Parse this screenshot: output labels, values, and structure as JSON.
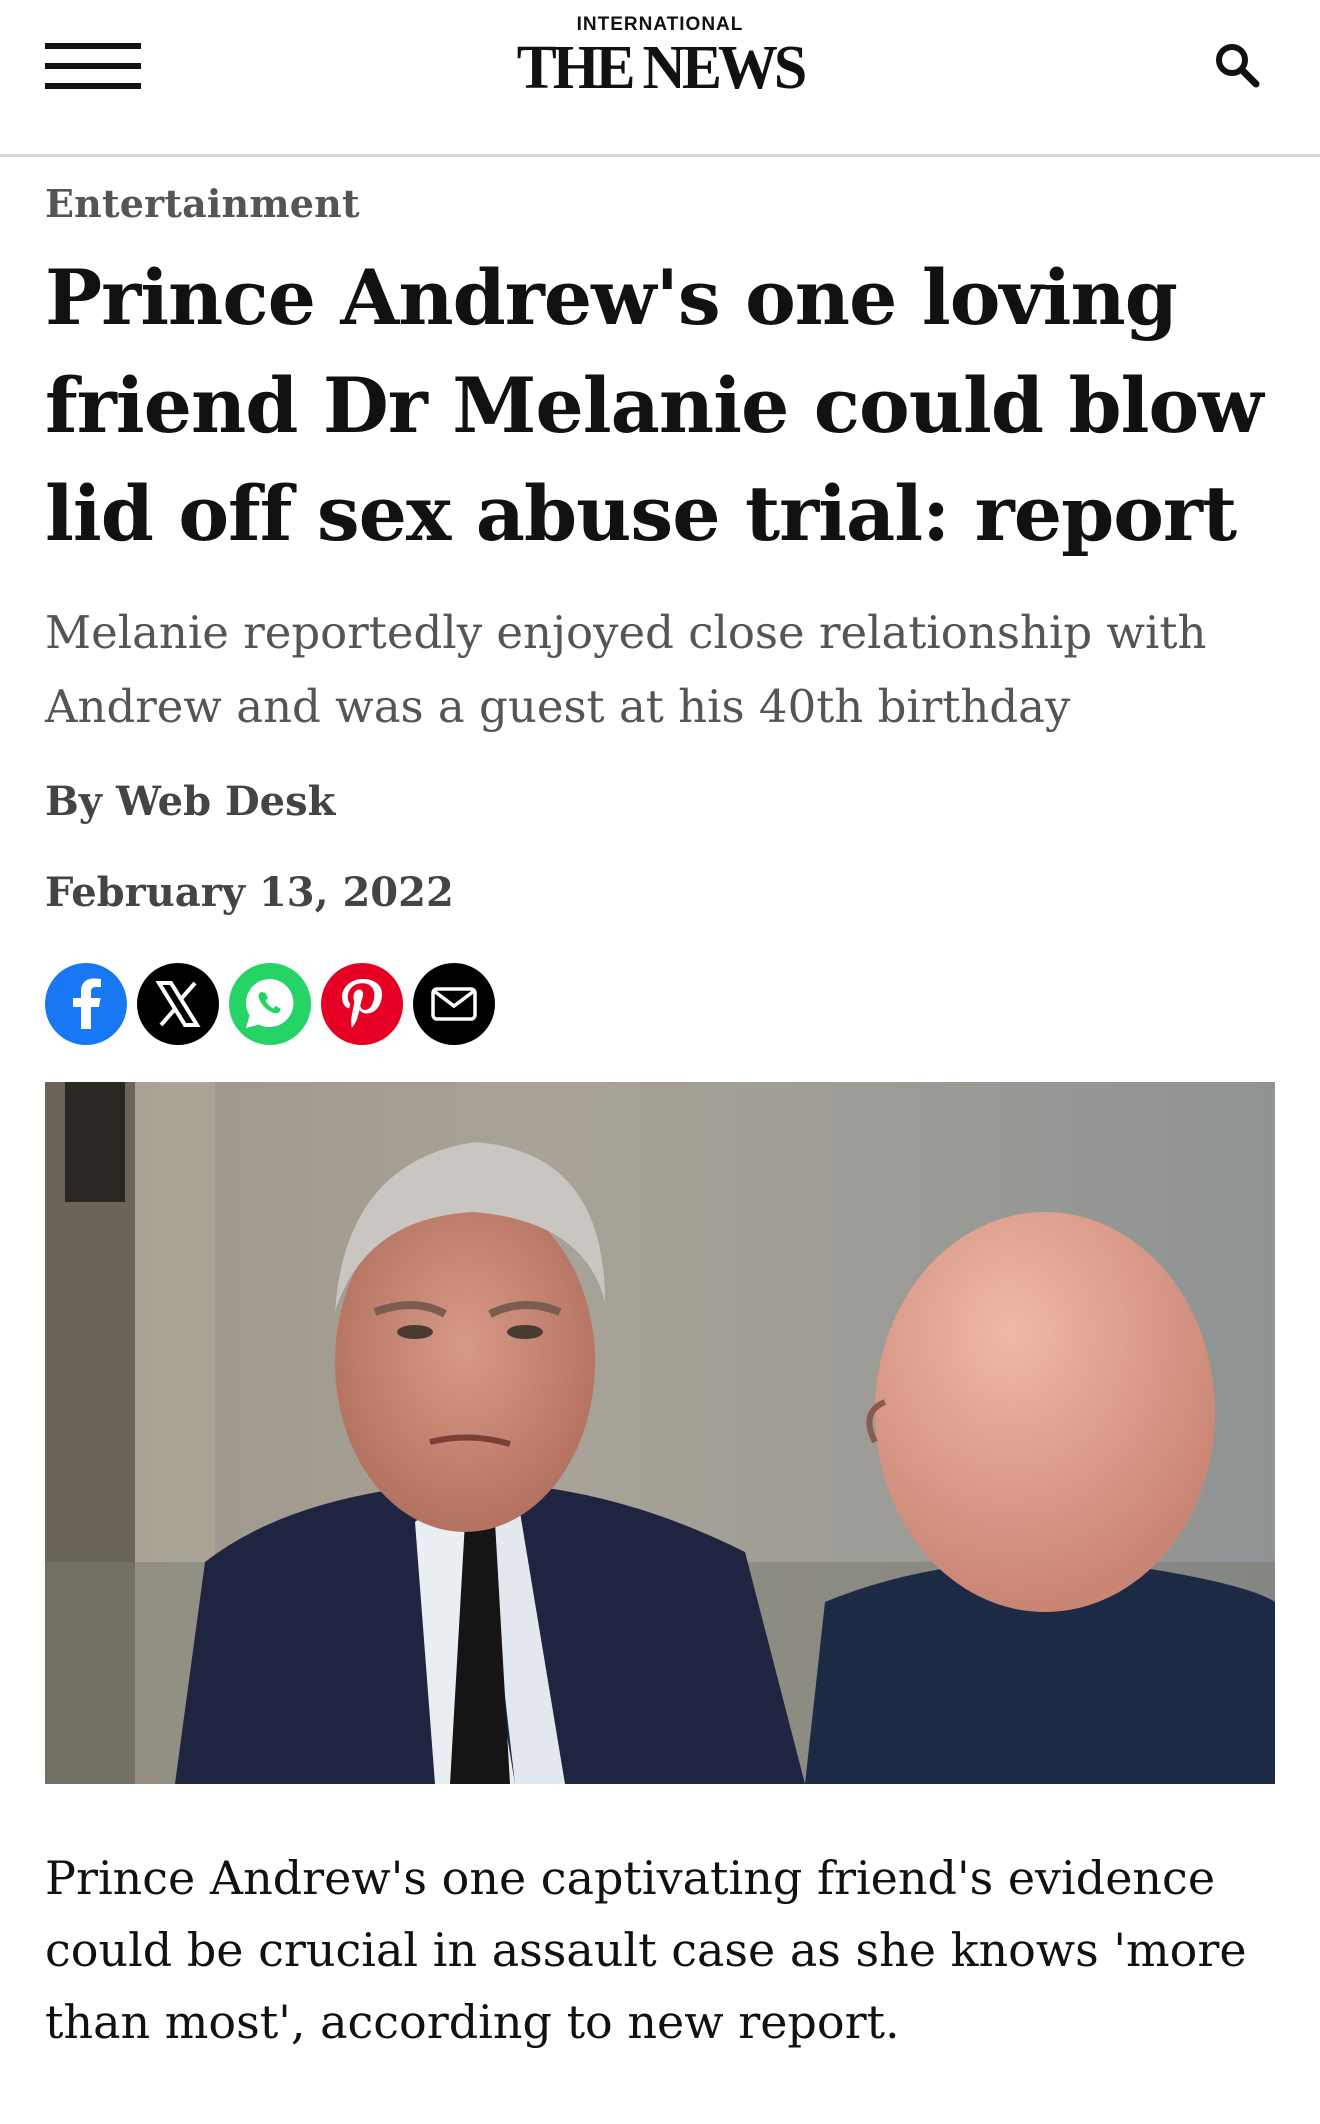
{
  "header": {
    "menu_icon": "hamburger-menu-icon",
    "logo_top": "INTERNATIONAL",
    "logo_main": "THE NEWS",
    "search_icon": "search-icon"
  },
  "article": {
    "category": "Entertainment",
    "headline": "Prince Andrew's one loving friend Dr Melanie could blow lid off sex abuse trial: report",
    "subheadline": "Melanie reportedly enjoyed close relationship with Andrew and was a guest at his 40th birthday",
    "byline": "By Web Desk",
    "date": "February 13, 2022",
    "share": [
      {
        "name": "facebook-icon",
        "color": "#1877f2"
      },
      {
        "name": "x-icon",
        "color": "#000000"
      },
      {
        "name": "whatsapp-icon",
        "color": "#25d366"
      },
      {
        "name": "pinterest-icon",
        "color": "#e60023"
      },
      {
        "name": "email-icon",
        "color": "#000000"
      }
    ],
    "photo_alt": "Prince Andrew in a navy suit speaking with a bald man",
    "lead": "Prince Andrew's one captivating friend's  evidence could be crucial in assault case as she knows 'more than most', according to new report."
  }
}
